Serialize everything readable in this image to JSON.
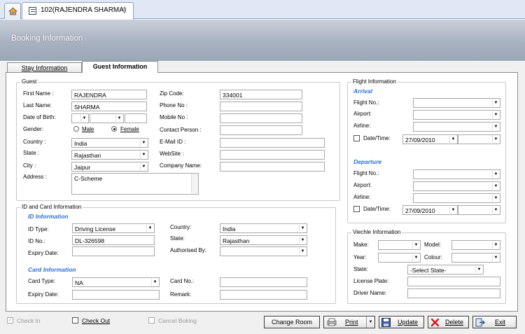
{
  "app": {
    "doc_tab_title": "102(RAJENDRA SHARMA)",
    "close_glyph": "×",
    "header_title": "Booking Information"
  },
  "tabs": {
    "stay": "Stay Information",
    "guest": "Guest Information"
  },
  "guest": {
    "title": "Guest",
    "first_name_label": "First Name :",
    "first_name": "RAJENDRA",
    "last_name_label": "Last Name:",
    "last_name": "SHARMA",
    "dob_label": "Date of Birth:",
    "gender_label": "Gender:",
    "male": "Male",
    "female": "Female",
    "country_label": "Country :",
    "country": "India",
    "state_label": "State :",
    "state": "Rajasthan",
    "city_label": "City :",
    "city": "Jaipur",
    "address_label": "Address :",
    "address": "C-Scheme",
    "zip_label": "Zip Code:",
    "zip": "334001",
    "phone_label": "Phone No :",
    "mobile_label": "Mobile No :",
    "contact_label": "Contact Person :",
    "email_label": "E-Mail ID :",
    "website_label": "WebSite :",
    "company_label": "Company Name:"
  },
  "idcard": {
    "title": "ID and Card Information",
    "id_info": "ID Information",
    "id_type_label": "ID Type:",
    "id_type": "Driving License",
    "id_no_label": "ID No.:",
    "id_no": "DL-326598",
    "expiry_label": "Expiry Date:",
    "country_label": "Country:",
    "country": "India",
    "state_label": "State:",
    "state": "Rajasthan",
    "auth_label": "Authorised By:",
    "card_info": "Card Information",
    "card_type_label": "Card Type:",
    "card_type": "NA",
    "card_expiry_label": "Expiry Date:",
    "card_no_label": "Card No.:",
    "remark_label": "Remark:"
  },
  "flight": {
    "title": "Flight Information",
    "arrival": "Arrival",
    "departure": "Departure",
    "flight_no_label": "Flight No.:",
    "airport_label": "Airport:",
    "airline_label": "Airline:",
    "datetime_label": "Date/Time:",
    "arr_date": "27/09/2010",
    "dep_date": "27/09/2010"
  },
  "vehicle": {
    "title": "Viechle Information",
    "make_label": "Make:",
    "model_label": "Model:",
    "year_label": "Year:",
    "colour_label": "Colour:",
    "state_label": "State:",
    "state": "-Select State-",
    "plate_label": "License Plate:",
    "driver_label": "Driver Name:"
  },
  "footer": {
    "checkin": "Check In",
    "checkout": "Check Out",
    "cancel": "Cancel Boking",
    "change_room": "Change Room",
    "print": "Print",
    "update": "Update",
    "delete": "Delete",
    "exit": "Exit"
  }
}
